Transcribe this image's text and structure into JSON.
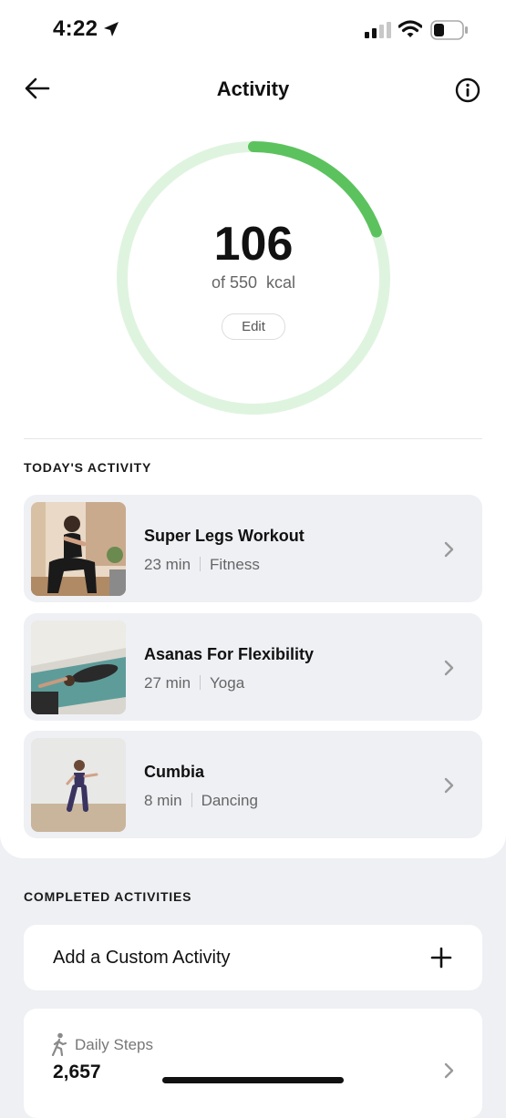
{
  "status_bar": {
    "time": "4:22"
  },
  "nav": {
    "title": "Activity"
  },
  "goal": {
    "current": "106",
    "subtitle": "of 550  kcal",
    "progress": 0.193,
    "edit_label": "Edit"
  },
  "colors": {
    "accent": "#5cc25e",
    "track": "#dff4df",
    "card_bg": "#eef0f4"
  },
  "todays_activity": {
    "heading": "TODAY'S ACTIVITY",
    "items": [
      {
        "title": "Super Legs Workout",
        "duration": "23 min",
        "category": "Fitness"
      },
      {
        "title": "Asanas For Flexibility",
        "duration": "27 min",
        "category": "Yoga"
      },
      {
        "title": "Cumbia",
        "duration": "8 min",
        "category": "Dancing"
      }
    ]
  },
  "completed": {
    "heading": "COMPLETED ACTIVITIES",
    "add_custom_label": "Add a Custom Activity"
  },
  "daily_steps": {
    "label": "Daily Steps",
    "value": "2,657"
  }
}
